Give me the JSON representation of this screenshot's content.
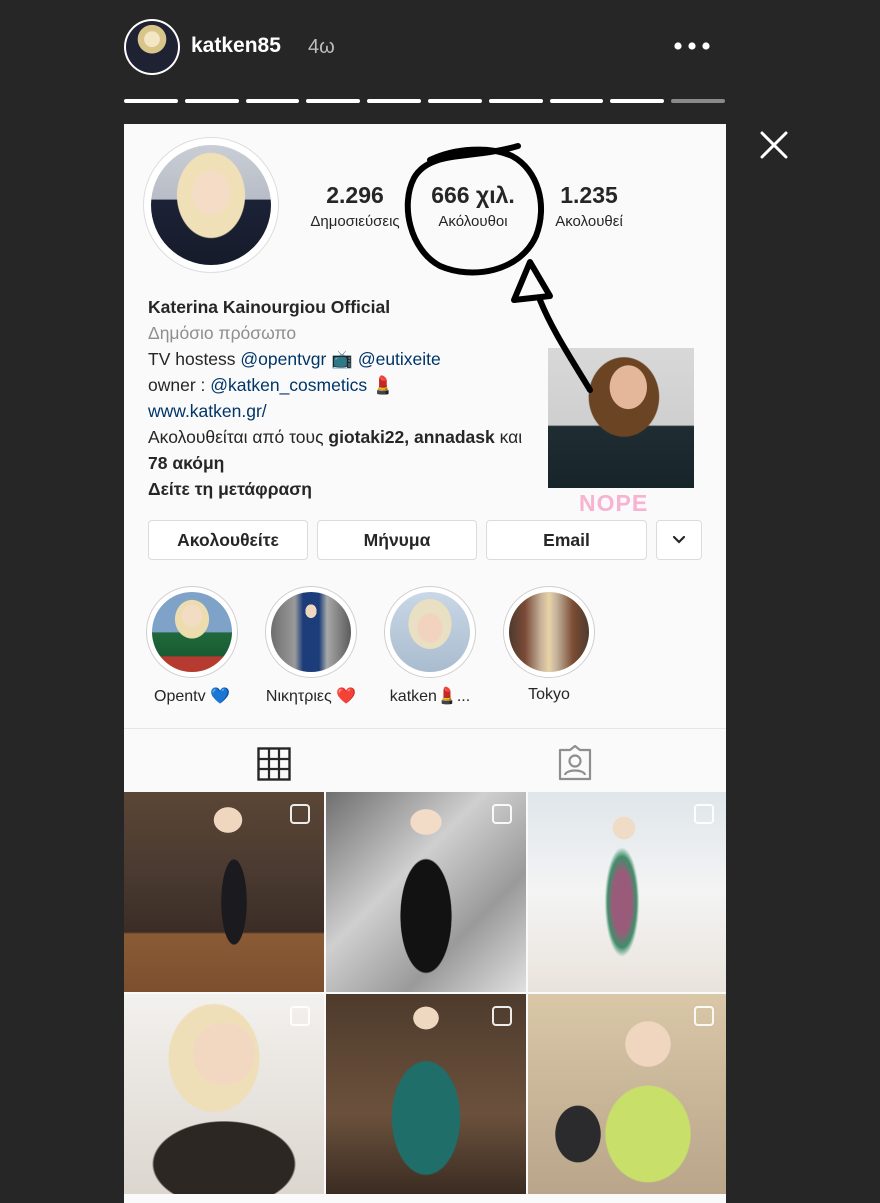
{
  "story": {
    "username": "katken85",
    "time": "4ω",
    "more_icon": "more-dots-icon",
    "close_icon": "close-icon"
  },
  "profile": {
    "stats": [
      {
        "value": "2.296",
        "label": "Δημοσιεύσεις"
      },
      {
        "value": "666 χιλ.",
        "label": "Ακόλουθοι"
      },
      {
        "value": "1.235",
        "label": "Ακολουθεί"
      }
    ],
    "name": "Katerina Kainourgiou Official",
    "category": "Δημόσιο πρόσωπο",
    "bio_line1_prefix": "TV hostess ",
    "bio_handle1": "@opentvgr",
    "bio_emoji1": "📺",
    "bio_handle2": "@eutixeite",
    "bio_line2_prefix": " owner : ",
    "bio_handle3": "@katken_cosmetics",
    "bio_emoji2": "💄",
    "website": "www.katken.gr/",
    "followed_by_prefix": "Ακολουθείται από τους ",
    "followed_by_names": "giotaki22, annadask",
    "followed_by_suffix": " και",
    "followed_by_more": "78 ακόμη",
    "translate": "Δείτε τη μετάφραση"
  },
  "buttons": {
    "follow": "Ακολουθείτε",
    "message": "Μήνυμα",
    "email": "Email",
    "dropdown_icon": "chevron-down-icon"
  },
  "highlights": [
    {
      "label": "Opentv 💙"
    },
    {
      "label": "Νικητριες ❤️"
    },
    {
      "label": "katken💄..."
    },
    {
      "label": "Tokyo"
    }
  ],
  "tabs": [
    {
      "icon": "grid-icon"
    },
    {
      "icon": "tagged-icon"
    }
  ],
  "sticker": {
    "text": "NOPE"
  },
  "colors": {
    "background": "#262626",
    "card": "#fafafa",
    "link": "#003569",
    "sticker_text": "#f7b3cf"
  }
}
